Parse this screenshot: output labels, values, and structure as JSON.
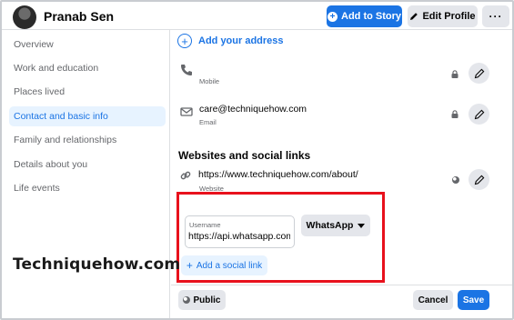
{
  "header": {
    "profile_name": "Pranab Sen",
    "add_to_story_label": "Add to Story",
    "edit_profile_label": "Edit Profile",
    "more_label": "···"
  },
  "sidebar": {
    "items": [
      {
        "label": "Overview"
      },
      {
        "label": "Work and education"
      },
      {
        "label": "Places lived"
      },
      {
        "label": "Contact and basic info"
      },
      {
        "label": "Family and relationships"
      },
      {
        "label": "Details about you"
      },
      {
        "label": "Life events"
      }
    ],
    "active_index": 3
  },
  "contact": {
    "add_address_label": "Add your address",
    "mobile_label": "Mobile",
    "email_value": "care@techniquehow.com",
    "email_label": "Email"
  },
  "websites": {
    "section_title": "Websites and social links",
    "website_value": "https://www.techniquehow.com/about/",
    "website_label": "Website",
    "username_label": "Username",
    "username_value": "https://api.whatsapp.com",
    "platform_selected": "WhatsApp",
    "add_social_link_label": "Add a social link"
  },
  "watermark": "Techniquehow.com",
  "footer": {
    "audience_label": "Public",
    "cancel_label": "Cancel",
    "save_label": "Save"
  },
  "colors": {
    "accent": "#1b74e4",
    "highlight_box": "#e8111c",
    "button_gray": "#e4e6eb"
  },
  "icons": [
    "plus-circle-icon",
    "pencil-icon",
    "phone-icon",
    "envelope-icon",
    "link-icon",
    "lock-icon",
    "globe-icon",
    "caret-down-icon"
  ]
}
